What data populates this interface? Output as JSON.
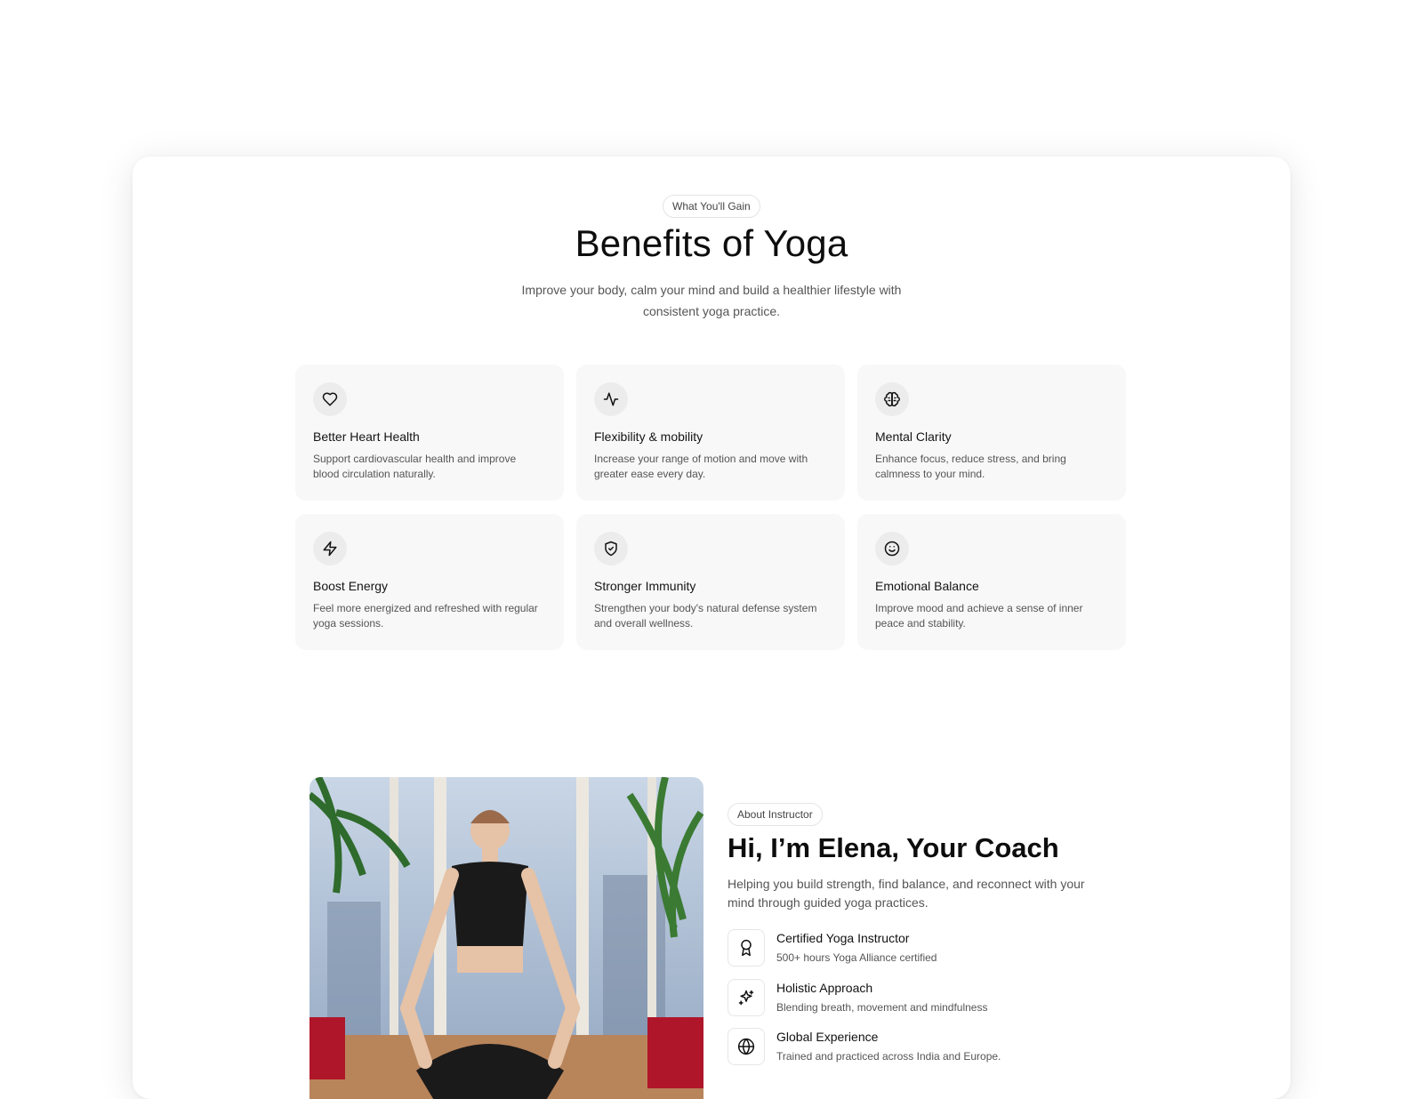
{
  "benefits": {
    "badge": "What You'll Gain",
    "title": "Benefits of Yoga",
    "subtitle_line1": "Improve your body, calm your mind and build a healthier lifestyle with",
    "subtitle_line2": "consistent yoga practice.",
    "cards": [
      {
        "icon": "heart-icon",
        "title": "Better Heart Health",
        "desc": "Support cardiovascular health and improve blood circulation naturally."
      },
      {
        "icon": "activity-icon",
        "title": "Flexibility & mobility",
        "desc": "Increase your range of motion and move with greater ease every day."
      },
      {
        "icon": "brain-icon",
        "title": "Mental Clarity",
        "desc": "Enhance focus, reduce stress, and bring calmness to your mind."
      },
      {
        "icon": "zap-icon",
        "title": "Boost Energy",
        "desc": "Feel more energized and refreshed with regular yoga sessions."
      },
      {
        "icon": "shield-check-icon",
        "title": "Stronger Immunity",
        "desc": "Strengthen your body's natural defense system and overall wellness."
      },
      {
        "icon": "smile-icon",
        "title": "Emotional Balance",
        "desc": "Improve mood and achieve a sense of inner peace and stability."
      }
    ]
  },
  "about": {
    "badge": "About Instructor",
    "title": "Hi, I’m Elena, Your Coach",
    "desc": "Helping you build strength, find balance, and reconnect with your mind through guided yoga practices.",
    "features": [
      {
        "icon": "award-icon",
        "title": "Certified Yoga Instructor",
        "desc": "500+ hours Yoga Alliance certified"
      },
      {
        "icon": "sparkles-icon",
        "title": "Holistic Approach",
        "desc": "Blending breath, movement and mindfulness"
      },
      {
        "icon": "globe-icon",
        "title": "Global Experience",
        "desc": "Trained and practiced across India and Europe."
      }
    ]
  }
}
